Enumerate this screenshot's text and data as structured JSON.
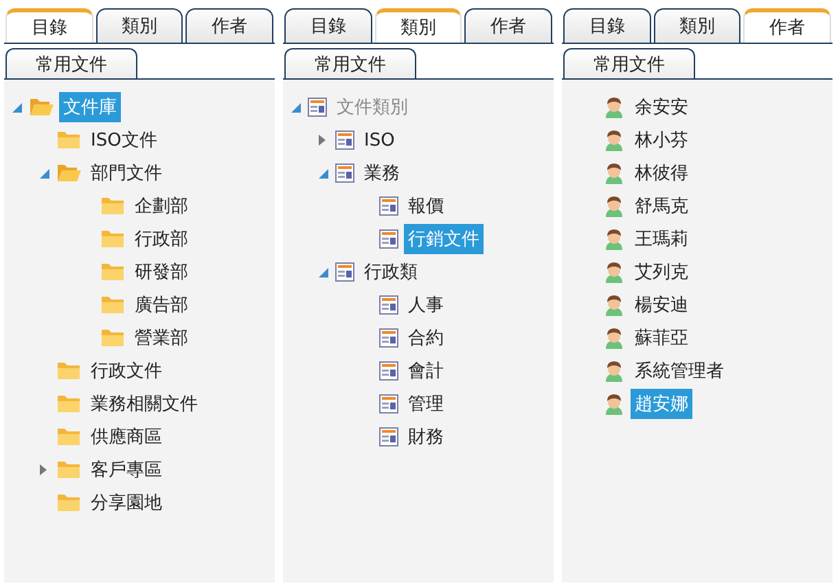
{
  "panels": [
    {
      "tabs": [
        {
          "label": "目錄",
          "selected": true
        },
        {
          "label": "類別",
          "selected": false
        },
        {
          "label": "作者",
          "selected": false
        }
      ],
      "button": "常用文件",
      "tree": [
        {
          "kind": "folder",
          "label": "文件庫",
          "expanded": true,
          "selected": true,
          "disabled": false,
          "children": [
            {
              "kind": "folder",
              "label": "ISO文件",
              "selected": false,
              "disabled": false
            },
            {
              "kind": "folder",
              "label": "部門文件",
              "expanded": true,
              "selected": false,
              "disabled": false,
              "children": [
                {
                  "kind": "folder",
                  "label": "企劃部",
                  "selected": false,
                  "disabled": false
                },
                {
                  "kind": "folder",
                  "label": "行政部",
                  "selected": false,
                  "disabled": false
                },
                {
                  "kind": "folder",
                  "label": "研發部",
                  "selected": false,
                  "disabled": false
                },
                {
                  "kind": "folder",
                  "label": "廣告部",
                  "selected": false,
                  "disabled": false
                },
                {
                  "kind": "folder",
                  "label": "營業部",
                  "selected": false,
                  "disabled": false
                }
              ]
            },
            {
              "kind": "folder",
              "label": "行政文件",
              "selected": false,
              "disabled": false
            },
            {
              "kind": "folder",
              "label": "業務相關文件",
              "selected": false,
              "disabled": false
            },
            {
              "kind": "folder",
              "label": "供應商區",
              "selected": false,
              "disabled": false
            },
            {
              "kind": "folder",
              "label": "客戶專區",
              "expanded": false,
              "selected": false,
              "disabled": false
            },
            {
              "kind": "folder",
              "label": "分享園地",
              "selected": false,
              "disabled": false
            }
          ]
        }
      ]
    },
    {
      "tabs": [
        {
          "label": "目錄",
          "selected": false
        },
        {
          "label": "類別",
          "selected": true
        },
        {
          "label": "作者",
          "selected": false
        }
      ],
      "button": "常用文件",
      "tree": [
        {
          "kind": "category",
          "label": "文件類別",
          "expanded": true,
          "selected": false,
          "disabled": true,
          "children": [
            {
              "kind": "category",
              "label": "ISO",
              "expanded": false,
              "selected": false,
              "disabled": false
            },
            {
              "kind": "category",
              "label": "業務",
              "expanded": true,
              "selected": false,
              "disabled": false,
              "children": [
                {
                  "kind": "category",
                  "label": "報價",
                  "selected": false,
                  "disabled": false
                },
                {
                  "kind": "category",
                  "label": "行銷文件",
                  "selected": true,
                  "disabled": false
                }
              ]
            },
            {
              "kind": "category",
              "label": "行政類",
              "expanded": true,
              "selected": false,
              "disabled": false,
              "children": [
                {
                  "kind": "category",
                  "label": "人事",
                  "selected": false,
                  "disabled": false
                },
                {
                  "kind": "category",
                  "label": "合約",
                  "selected": false,
                  "disabled": false
                },
                {
                  "kind": "category",
                  "label": "會計",
                  "selected": false,
                  "disabled": false
                },
                {
                  "kind": "category",
                  "label": "管理",
                  "selected": false,
                  "disabled": false
                },
                {
                  "kind": "category",
                  "label": "財務",
                  "selected": false,
                  "disabled": false
                }
              ]
            }
          ]
        }
      ]
    },
    {
      "tabs": [
        {
          "label": "目錄",
          "selected": false
        },
        {
          "label": "類別",
          "selected": false
        },
        {
          "label": "作者",
          "selected": true
        }
      ],
      "button": "常用文件",
      "tree": [
        {
          "kind": "person",
          "label": "余安安",
          "selected": false,
          "disabled": false
        },
        {
          "kind": "person",
          "label": "林小芬",
          "selected": false,
          "disabled": false
        },
        {
          "kind": "person",
          "label": "林彼得",
          "selected": false,
          "disabled": false
        },
        {
          "kind": "person",
          "label": "舒馬克",
          "selected": false,
          "disabled": false
        },
        {
          "kind": "person",
          "label": "王瑪莉",
          "selected": false,
          "disabled": false
        },
        {
          "kind": "person",
          "label": "艾列克",
          "selected": false,
          "disabled": false
        },
        {
          "kind": "person",
          "label": "楊安迪",
          "selected": false,
          "disabled": false
        },
        {
          "kind": "person",
          "label": "蘇菲亞",
          "selected": false,
          "disabled": false
        },
        {
          "kind": "person",
          "label": "系統管理者",
          "selected": false,
          "disabled": false
        },
        {
          "kind": "person",
          "label": "趙安娜",
          "selected": true,
          "disabled": false
        }
      ]
    }
  ]
}
